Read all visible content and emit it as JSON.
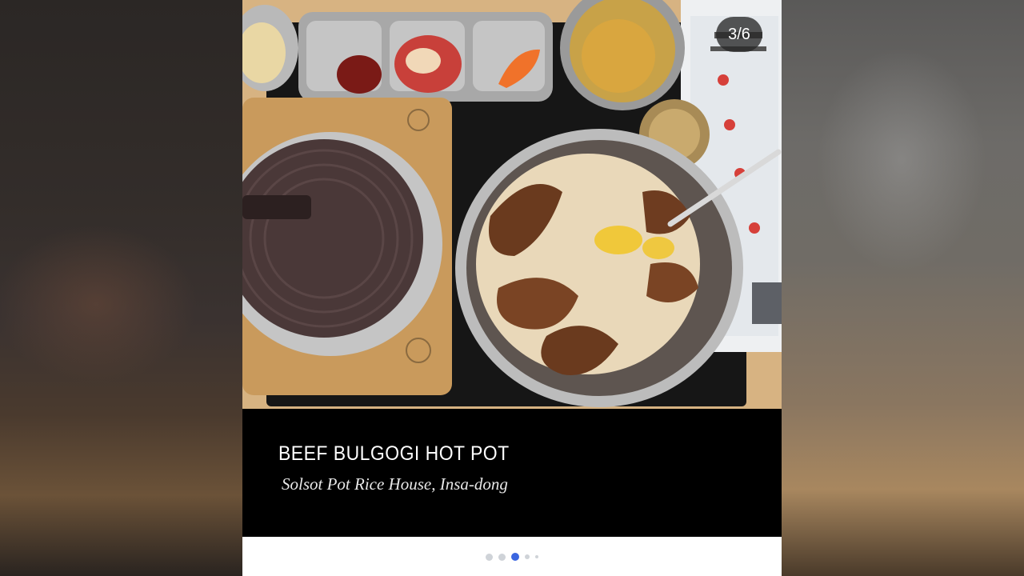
{
  "slide": {
    "counter": "3/6",
    "current": 3,
    "total": 6
  },
  "photo": {
    "alt_subject": "beef bulgogi rice bowl with side dishes and hot pot"
  },
  "caption": {
    "title": "BEEF BULGOGI HOT POT",
    "subtitle": "Solsot Pot Rice House, Insa-dong"
  },
  "pagination": {
    "dots": 5,
    "active_index": 2,
    "active_color": "#3b66e0",
    "inactive_color": "#cfd3d8"
  }
}
